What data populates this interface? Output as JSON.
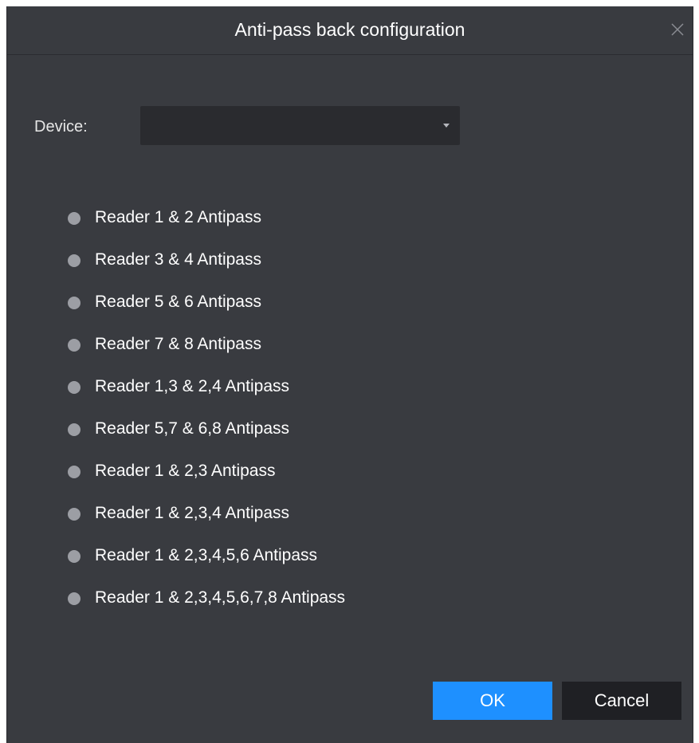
{
  "dialog": {
    "title": "Anti-pass back configuration",
    "close_icon": "close-icon"
  },
  "device": {
    "label": "Device:",
    "value": "",
    "dropdown_icon": "caret-down-icon"
  },
  "options": [
    {
      "label": "Reader 1 & 2 Antipass",
      "selected": false
    },
    {
      "label": "Reader 3 & 4 Antipass",
      "selected": false
    },
    {
      "label": "Reader 5 & 6 Antipass",
      "selected": false
    },
    {
      "label": "Reader 7 & 8 Antipass",
      "selected": false
    },
    {
      "label": "Reader 1,3 & 2,4 Antipass",
      "selected": false
    },
    {
      "label": "Reader 5,7 & 6,8 Antipass",
      "selected": false
    },
    {
      "label": "Reader 1 & 2,3 Antipass",
      "selected": false
    },
    {
      "label": "Reader 1 & 2,3,4 Antipass",
      "selected": false
    },
    {
      "label": "Reader 1 & 2,3,4,5,6 Antipass",
      "selected": false
    },
    {
      "label": "Reader 1 & 2,3,4,5,6,7,8 Antipass",
      "selected": false
    }
  ],
  "buttons": {
    "ok_label": "OK",
    "cancel_label": "Cancel"
  },
  "colors": {
    "background": "#393b40",
    "field": "#2a2b2f",
    "primary": "#1e90ff",
    "secondary_button": "#1f2024",
    "radio": "#9c9ea4",
    "text": "#ffffff"
  }
}
